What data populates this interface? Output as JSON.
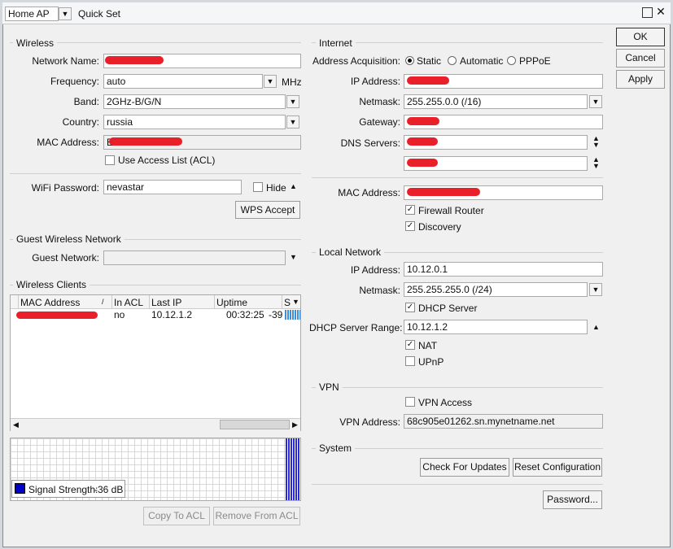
{
  "titlebar": {
    "mode_value": "Home AP",
    "title": "Quick Set"
  },
  "buttons": {
    "ok": "OK",
    "cancel": "Cancel",
    "apply": "Apply"
  },
  "wireless": {
    "section": "Wireless",
    "network_name_label": "Network Name:",
    "frequency_label": "Frequency:",
    "frequency_value": "auto",
    "frequency_unit": "MHz",
    "band_label": "Band:",
    "band_value": "2GHz-B/G/N",
    "country_label": "Country:",
    "country_value": "russia",
    "mac_label": "MAC Address:",
    "mac_prefix": "E",
    "acl_label": "Use Access List (ACL)",
    "wifi_password_label": "WiFi Password:",
    "wifi_password_value": "nevastar",
    "hide_label": "Hide",
    "wps_button": "WPS Accept"
  },
  "guest": {
    "section": "Guest Wireless Network",
    "network_label": "Guest Network:"
  },
  "clients": {
    "section": "Wireless Clients",
    "columns": [
      "MAC Address",
      "In ACL",
      "Last IP",
      "Uptime",
      "S"
    ],
    "rows": [
      {
        "in_acl": "no",
        "last_ip": "10.12.1.2",
        "uptime": "00:32:25",
        "signal": "-39"
      }
    ],
    "signal_label": "Signal Strength:",
    "signal_value": "-36 dB",
    "copy_button": "Copy To ACL",
    "remove_button": "Remove From ACL"
  },
  "internet": {
    "section": "Internet",
    "acquisition_label": "Address Acquisition:",
    "options": [
      "Static",
      "Automatic",
      "PPPoE"
    ],
    "ip_label": "IP Address:",
    "netmask_label": "Netmask:",
    "netmask_value": "255.255.0.0 (/16)",
    "gateway_label": "Gateway:",
    "dns_label": "DNS Servers:",
    "mac_label": "MAC Address:",
    "firewall_label": "Firewall Router",
    "discovery_label": "Discovery"
  },
  "local": {
    "section": "Local Network",
    "ip_label": "IP Address:",
    "ip_value": "10.12.0.1",
    "netmask_label": "Netmask:",
    "netmask_value": "255.255.255.0 (/24)",
    "dhcp_label": "DHCP Server",
    "range_label": "DHCP Server Range:",
    "range_value": "10.12.1.2",
    "nat_label": "NAT",
    "upnp_label": "UPnP"
  },
  "vpn": {
    "section": "VPN",
    "access_label": "VPN Access",
    "address_label": "VPN Address:",
    "address_value": "68c905e01262.sn.mynetname.net"
  },
  "system": {
    "section": "System",
    "check_updates": "Check For Updates",
    "reset_config": "Reset Configuration",
    "password_button": "Password..."
  },
  "colors": {
    "redaction": "#e8141e",
    "signal_swatch": "#0000cc",
    "signal_bars": "#2a2ad0"
  }
}
